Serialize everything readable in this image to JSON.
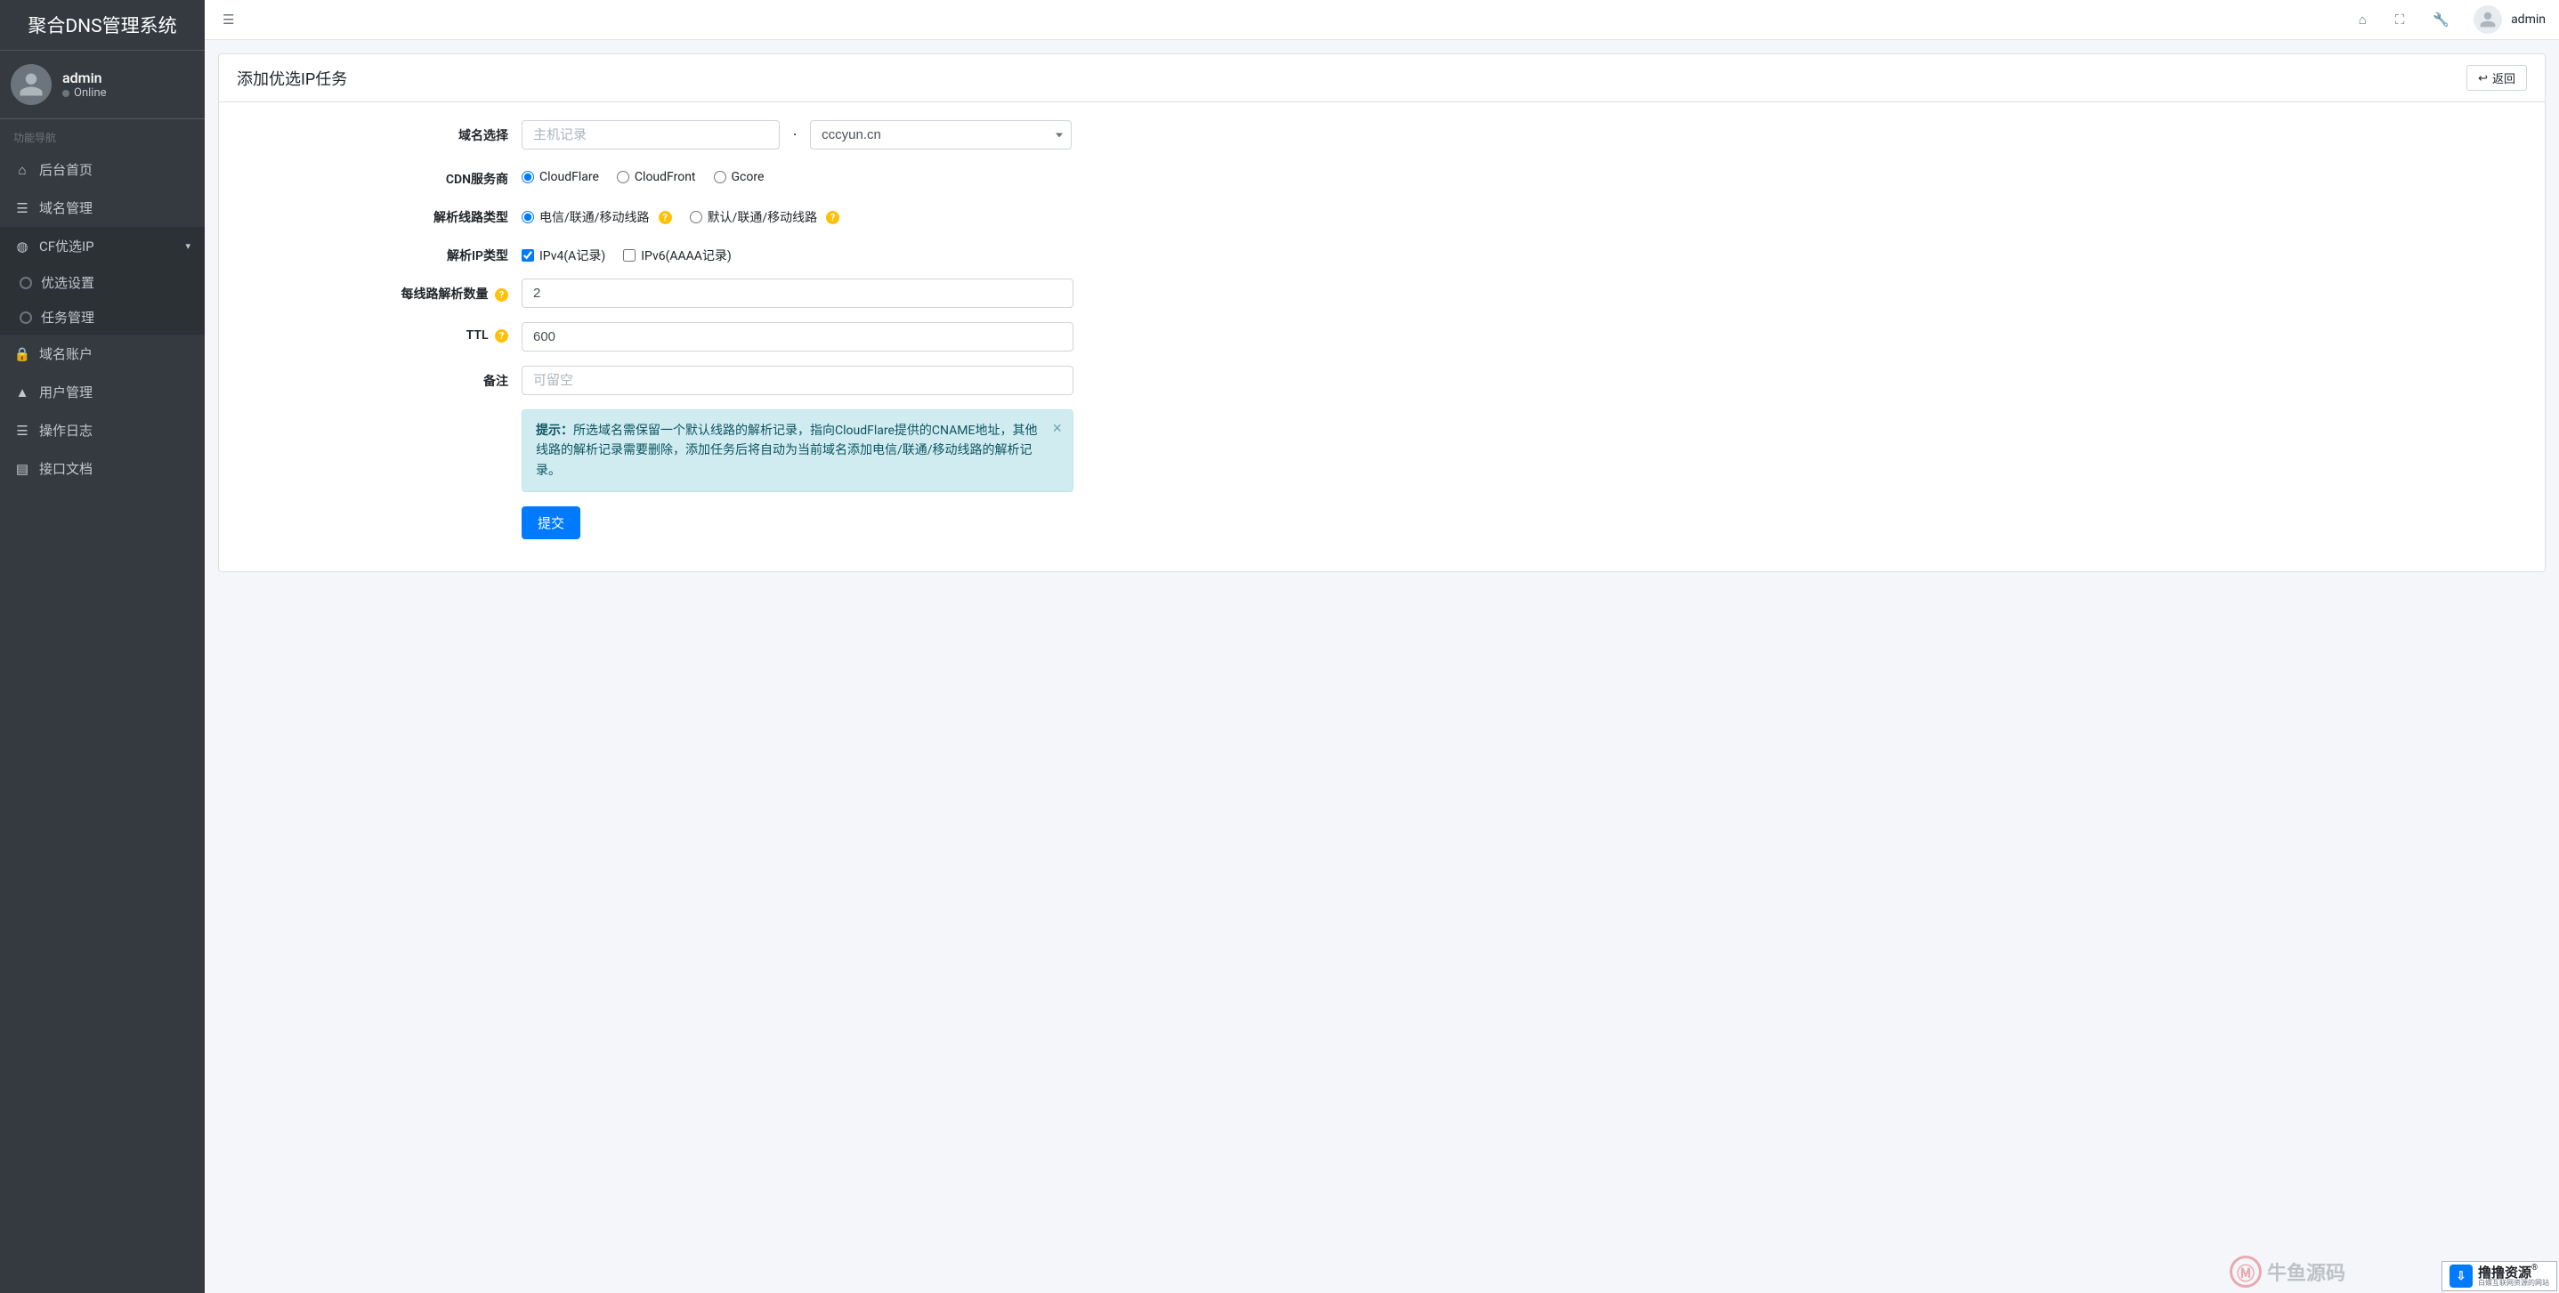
{
  "brand": "聚合DNS管理系统",
  "sidebar": {
    "user": {
      "name": "admin",
      "status": "Online"
    },
    "section_title": "功能导航",
    "items": [
      {
        "label": "后台首页",
        "icon": "home"
      },
      {
        "label": "域名管理",
        "icon": "list"
      },
      {
        "label": "CF优选IP",
        "icon": "globe",
        "expanded": true,
        "children": [
          {
            "label": "优选设置"
          },
          {
            "label": "任务管理"
          }
        ]
      },
      {
        "label": "域名账户",
        "icon": "lock"
      },
      {
        "label": "用户管理",
        "icon": "user"
      },
      {
        "label": "操作日志",
        "icon": "list"
      },
      {
        "label": "接口文档",
        "icon": "book"
      }
    ]
  },
  "topbar": {
    "user": "admin"
  },
  "page": {
    "title": "添加优选IP任务",
    "back_label": "返回"
  },
  "form": {
    "domain": {
      "label": "域名选择",
      "host_placeholder": "主机记录",
      "separator": "·",
      "selected_domain": "cccyun.cn"
    },
    "cdn": {
      "label": "CDN服务商",
      "options": [
        "CloudFlare",
        "CloudFront",
        "Gcore"
      ],
      "selected": "CloudFlare"
    },
    "line_type": {
      "label": "解析线路类型",
      "options": [
        "电信/联通/移动线路",
        "默认/联通/移动线路"
      ],
      "selected_index": 0
    },
    "ip_type": {
      "label": "解析IP类型",
      "options": [
        {
          "label": "IPv4(A记录)",
          "checked": true
        },
        {
          "label": "IPv6(AAAA记录)",
          "checked": false
        }
      ]
    },
    "count": {
      "label": "每线路解析数量",
      "value": "2"
    },
    "ttl": {
      "label": "TTL",
      "value": "600"
    },
    "remark": {
      "label": "备注",
      "placeholder": "可留空"
    },
    "alert": {
      "prefix": "提示：",
      "text": "所选域名需保留一个默认线路的解析记录，指向CloudFlare提供的CNAME地址，其他线路的解析记录需要删除，添加任务后将自动为当前域名添加电信/联通/移动线路的解析记录。"
    },
    "submit_label": "提交"
  },
  "watermarks": {
    "w1": "牛鱼源码",
    "w2_main": "撸撸资源",
    "w2_sub": "白嫖互联网资源的网站"
  }
}
